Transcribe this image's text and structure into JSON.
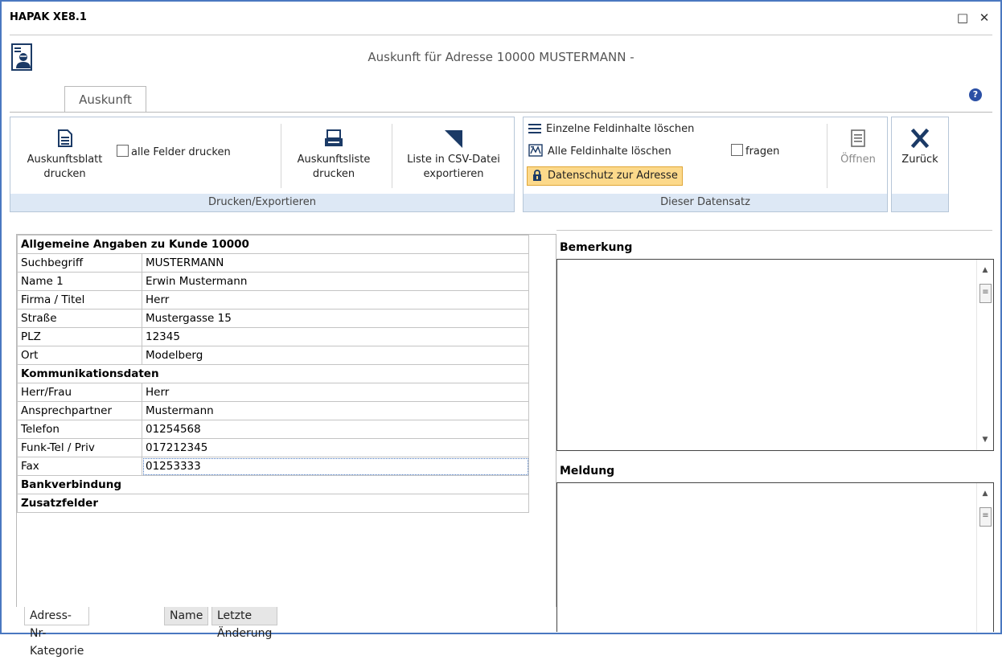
{
  "window": {
    "title": "HAPAK XE8.1",
    "maximize_glyph": "□",
    "close_glyph": "✕"
  },
  "header": {
    "title": "Auskunft für Adresse 10000 MUSTERMANN -",
    "icon": "contact-card-icon",
    "help_glyph": "?"
  },
  "tabs": [
    {
      "label": "Auskunft"
    }
  ],
  "ribbon": {
    "print_group": {
      "label": "Drucken/Exportieren",
      "print_sheet": {
        "line1": "Auskunftsblatt",
        "line2": "drucken"
      },
      "all_fields": "alle Felder drucken",
      "print_list": {
        "line1": "Auskunftsliste",
        "line2": "drucken"
      },
      "export_csv": {
        "line1": "Liste in CSV-Datei",
        "line2": "exportieren"
      }
    },
    "record_group": {
      "label": "Dieser Datensatz",
      "clear_single": "Einzelne Feldinhalte löschen",
      "clear_all": "Alle Feldinhalte löschen",
      "ask": "fragen",
      "privacy": "Datenschutz zur Adresse",
      "open": "Öffnen"
    },
    "back": "Zurück"
  },
  "info": {
    "general_header": "Allgemeine Angaben zu Kunde 10000",
    "general": [
      {
        "key": "Suchbegriff",
        "value": "MUSTERMANN"
      },
      {
        "key": "Name 1",
        "value": "Erwin Mustermann"
      },
      {
        "key": "Firma / Titel",
        "value": "Herr"
      },
      {
        "key": "Straße",
        "value": "Mustergasse 15"
      },
      {
        "key": "PLZ",
        "value": "12345"
      },
      {
        "key": "Ort",
        "value": "Modelberg"
      }
    ],
    "comm_header": "Kommunikationsdaten",
    "comm": [
      {
        "key": "Herr/Frau",
        "value": "Herr"
      },
      {
        "key": "Ansprechpartner",
        "value": "Mustermann"
      },
      {
        "key": "Telefon",
        "value": "01254568"
      },
      {
        "key": "Funk-Tel / Priv",
        "value": "017212345"
      },
      {
        "key": "Fax",
        "value": "01253333"
      }
    ],
    "bank_header": "Bankverbindung",
    "extra_header": "Zusatzfelder"
  },
  "bottom_tabs": [
    {
      "label": "Adress-Nr-Kategorie"
    },
    {
      "label": "Name"
    },
    {
      "label": "Letzte Änderung"
    }
  ],
  "right": {
    "remark_label": "Bemerkung",
    "message_label": "Meldung"
  },
  "colors": {
    "accent": "#4a78c0",
    "group_label_bg": "#dde8f5",
    "highlight": "#fcd98b",
    "help": "#2a4fa5"
  }
}
